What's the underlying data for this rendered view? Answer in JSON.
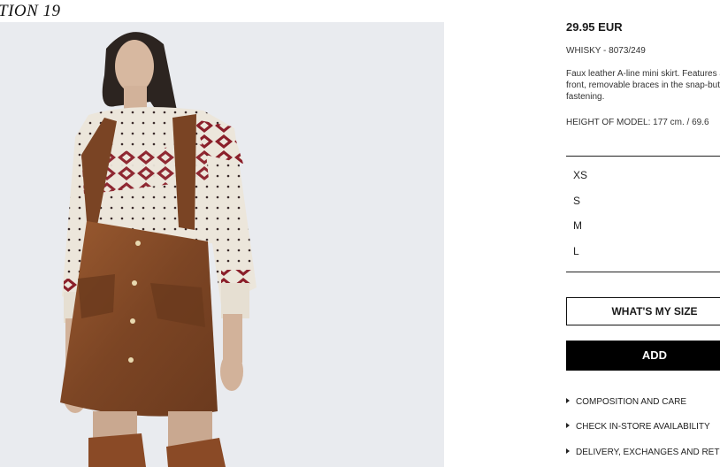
{
  "collection": {
    "title": "TION 19"
  },
  "product": {
    "price": "29.95 EUR",
    "ref": "WHISKY - 8073/249",
    "description": "Faux leather A-line mini skirt. Features at the front, removable braces in the snap-button fastening.",
    "model_height": "HEIGHT OF MODEL: 177 cm. / 69.6"
  },
  "sizes": [
    "XS",
    "S",
    "M",
    "L"
  ],
  "actions": {
    "size_guide": "WHAT'S MY SIZE",
    "add": "ADD"
  },
  "links": [
    "COMPOSITION AND CARE",
    "CHECK IN-STORE AVAILABILITY",
    "DELIVERY, EXCHANGES AND RETURNS"
  ],
  "colors": {
    "skirt": "#8a4f2a",
    "sweater": "#ece6db",
    "pattern": "#8b1f2a",
    "background": "#e9ebef"
  }
}
